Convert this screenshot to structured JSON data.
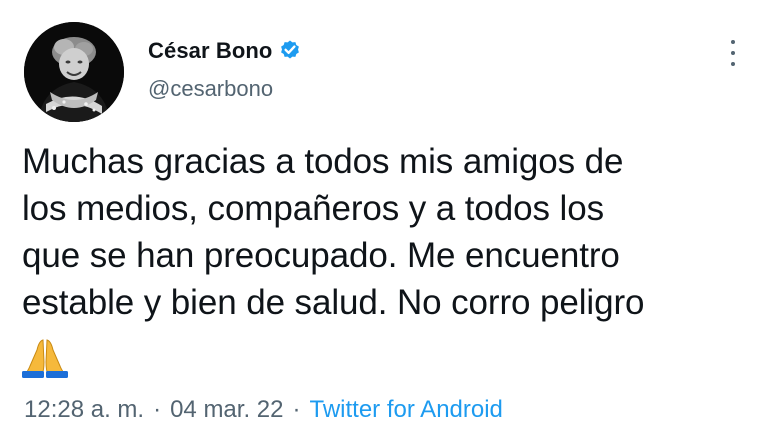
{
  "author": {
    "display_name": "César Bono",
    "handle": "@cesarbono",
    "verified": true,
    "avatar": "profile-photo-black-and-white"
  },
  "tweet": {
    "text": "Muchas gracias a todos mis amigos de\nlos medios, compañeros y a todos los\nque se han preocupado. Me encuentro\nestable y bien de salud. No corro peligro",
    "emoji": "folded-hands-emoji"
  },
  "meta": {
    "time": "12:28 a. m.",
    "separator": "·",
    "date": "04 mar. 22",
    "source": "Twitter for Android"
  },
  "icons": {
    "more": "more-vertical-icon",
    "verified": "verified-badge-icon"
  },
  "colors": {
    "text": "#0f1419",
    "secondary": "#536471",
    "link": "#1d9bf0",
    "verified": "#1d9bf0"
  }
}
